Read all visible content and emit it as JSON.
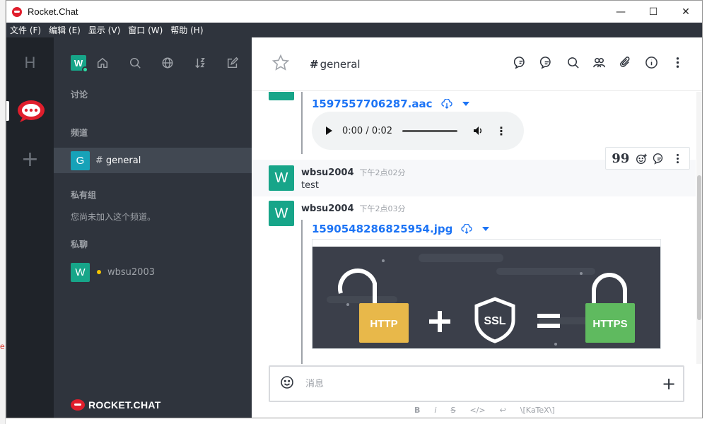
{
  "window": {
    "title": "Rocket.Chat",
    "minimize": "—",
    "maximize": "☐",
    "close": "✕"
  },
  "menu": [
    "文件 (F)",
    "编辑 (E)",
    "显示 (V)",
    "窗口 (W)",
    "帮助 (H)"
  ],
  "rail": {
    "server_letter": "H",
    "add": "+"
  },
  "sidebar": {
    "user_avatar": "W",
    "sections": {
      "discussions": "讨论",
      "channels": "频道",
      "private_groups": "私有组",
      "direct": "私聊"
    },
    "channel": {
      "avatar": "G",
      "name": "general",
      "avatar_color": "#17a2b8"
    },
    "private_empty": "您尚未加入这个频道。",
    "dm": {
      "avatar": "W",
      "name": "wbsu2003"
    },
    "footer_logo": "ROCKET.CHAT"
  },
  "room": {
    "name": "general"
  },
  "messages": {
    "audio_file": {
      "name": "1597557706287.aac",
      "time_display": "0:00 / 0:02"
    },
    "text_msg": {
      "author": "wbsu2004",
      "time": "下午2点02分",
      "body": "test"
    },
    "image_msg": {
      "author": "wbsu2004",
      "time": "下午2点03分",
      "file": "1590548286825954.jpg",
      "avatar": "W"
    },
    "image": {
      "http": "HTTP",
      "ssl": "SSL",
      "https": "HTTPS"
    }
  },
  "composer": {
    "placeholder": "消息",
    "formatting": [
      "B",
      "i",
      "S",
      "</>",
      "↩",
      "\\[KaTeX\\]"
    ]
  },
  "colors": {
    "accent": "#1d74f5",
    "avatar": "#17a589",
    "sidebar": "#2f343d",
    "rail": "#1f2329"
  }
}
